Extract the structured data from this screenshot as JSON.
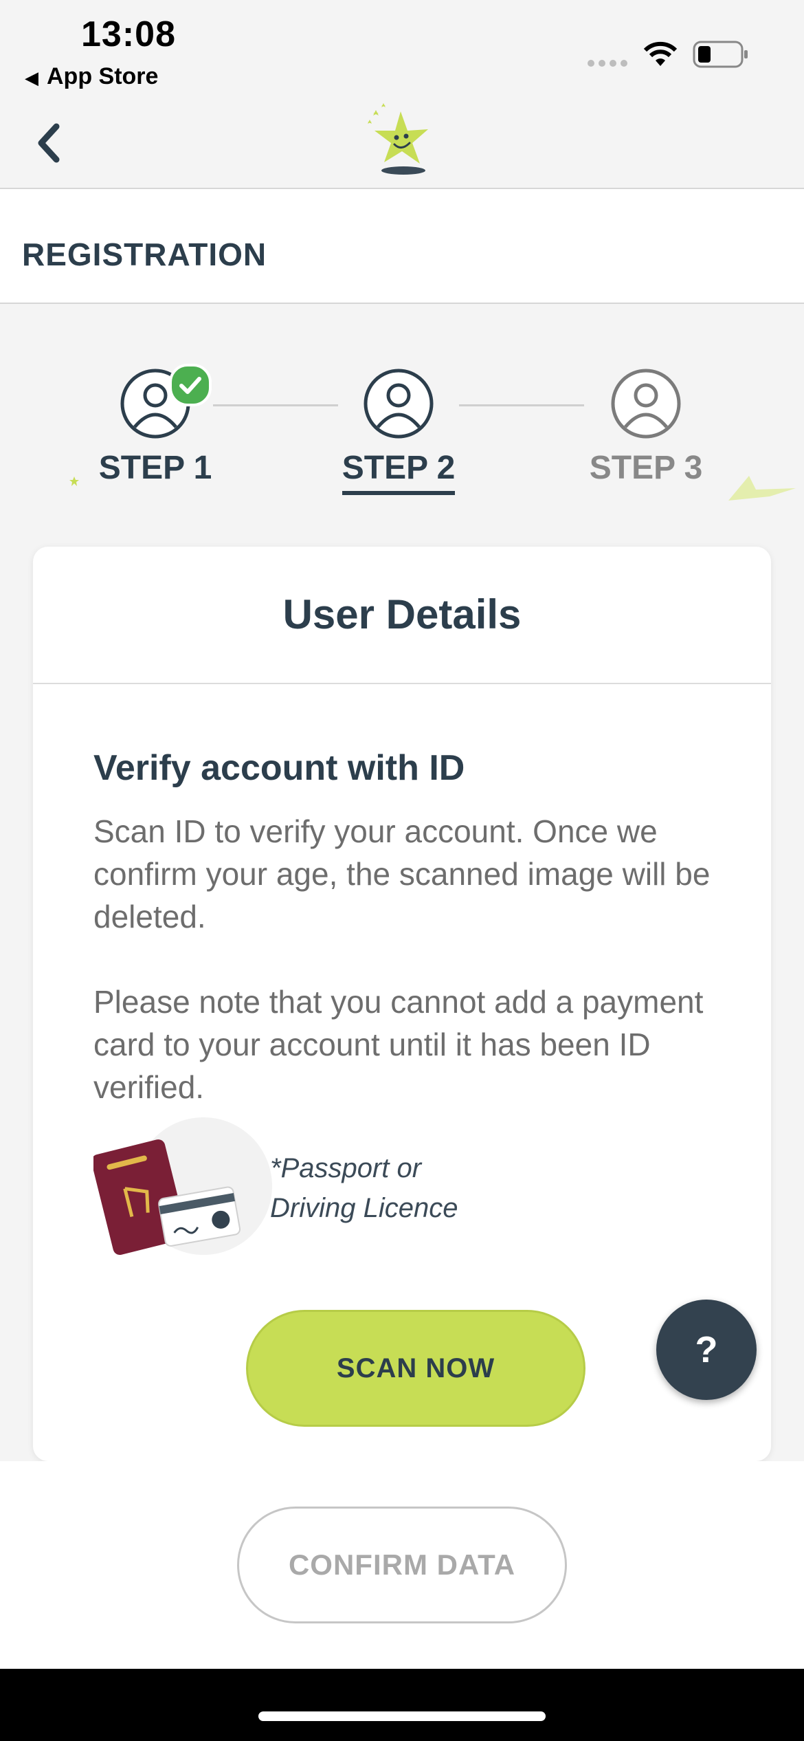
{
  "status_bar": {
    "time": "13:08",
    "back_app": "App Store",
    "icons": [
      "signal-icon",
      "wifi-icon",
      "battery-icon"
    ]
  },
  "nav": {
    "back_icon": "chevron-left-icon",
    "logo_icon": "star-mascot-logo"
  },
  "header": {
    "title": "REGISTRATION"
  },
  "steps": [
    {
      "label": "STEP 1",
      "state": "completed"
    },
    {
      "label": "STEP 2",
      "state": "active"
    },
    {
      "label": "STEP 3",
      "state": "upcoming"
    }
  ],
  "card": {
    "title": "User Details",
    "verify_title": "Verify account with ID",
    "paragraph_1": "Scan ID to verify your account. Once we confirm your age, the scanned image will be deleted.",
    "paragraph_2": "Please note that you cannot add a payment card to your account until it has been ID verified.",
    "doc_note_line1": "*Passport or",
    "doc_note_line2": "Driving Licence",
    "scan_button": "SCAN NOW"
  },
  "help_button": "?",
  "footer": {
    "confirm_button": "CONFIRM DATA"
  },
  "colors": {
    "accent_green": "#c7dd55",
    "dark_navy": "#2c3e4c",
    "success_green": "#4caf50"
  }
}
